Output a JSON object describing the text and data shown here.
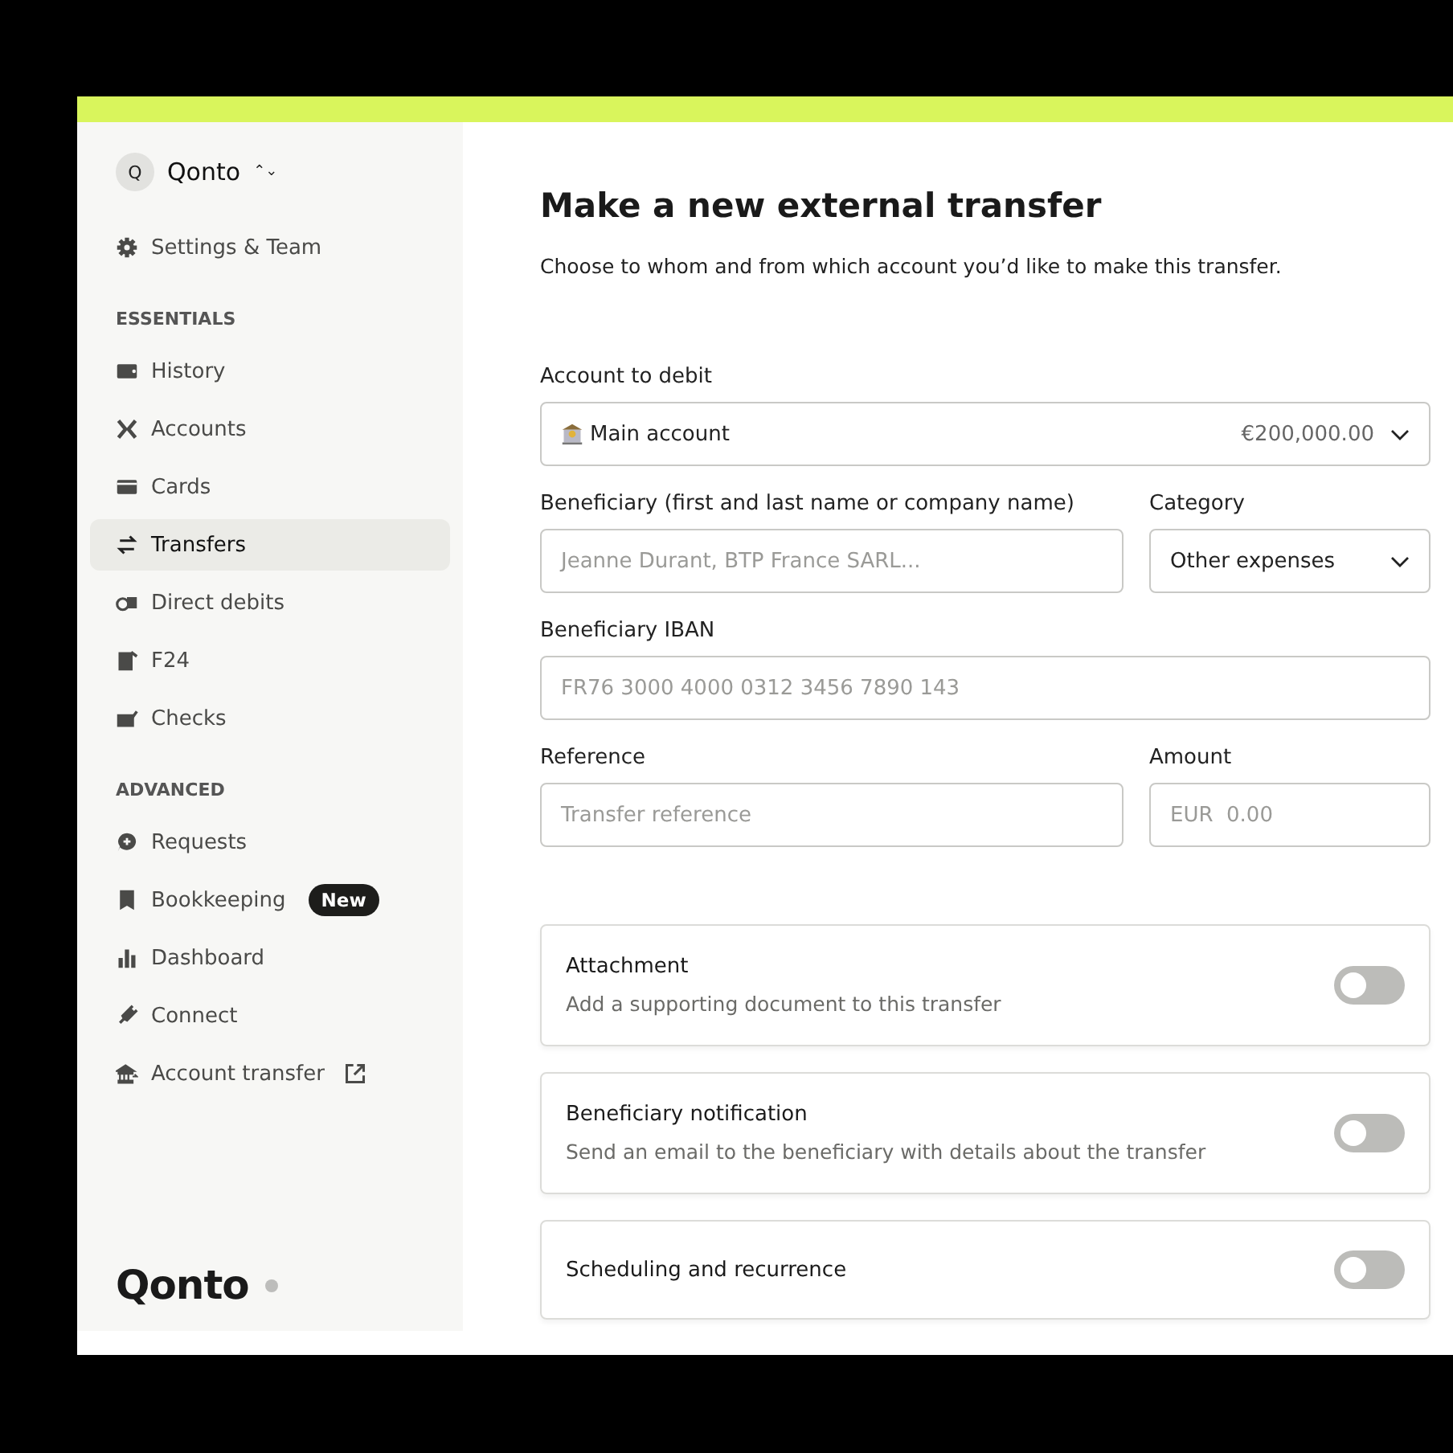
{
  "org": {
    "avatar": "Q",
    "name": "Qonto",
    "switch_icon": "⌃⌄"
  },
  "settings": {
    "label": "Settings & Team"
  },
  "sections": [
    {
      "title": "ESSENTIALS",
      "items": [
        {
          "label": "History",
          "selected": false
        },
        {
          "label": "Accounts",
          "selected": false
        },
        {
          "label": "Cards",
          "selected": false
        },
        {
          "label": "Transfers",
          "selected": true
        },
        {
          "label": "Direct debits",
          "selected": false
        },
        {
          "label": "F24",
          "selected": false
        },
        {
          "label": "Checks",
          "selected": false
        }
      ]
    },
    {
      "title": "ADVANCED",
      "items": [
        {
          "label": "Requests",
          "selected": false
        },
        {
          "label": "Bookkeeping",
          "selected": false,
          "badge": "New"
        },
        {
          "label": "Dashboard",
          "selected": false
        },
        {
          "label": "Connect",
          "selected": false
        },
        {
          "label": "Account transfer",
          "selected": false,
          "external": true
        }
      ]
    }
  ],
  "logo": "Qonto",
  "page": {
    "title": "Make a new external transfer",
    "subtitle": "Choose to whom and from which account you’d like to make this transfer."
  },
  "account": {
    "label": "Account to debit",
    "value": "Main account",
    "balance": "€200,000.00"
  },
  "beneficiary": {
    "label": "Beneficiary (first and last name or company name)",
    "placeholder": "Jeanne Durant, BTP France SARL..."
  },
  "category": {
    "label": "Category",
    "value": "Other expenses"
  },
  "iban": {
    "label": "Beneficiary IBAN",
    "placeholder": "FR76 3000 4000 0312 3456 7890 143"
  },
  "reference": {
    "label": "Reference",
    "placeholder": "Transfer reference"
  },
  "amount": {
    "label": "Amount",
    "placeholder": "EUR  0.00"
  },
  "options": [
    {
      "title": "Attachment",
      "description": "Add a supporting document to this transfer",
      "on": false
    },
    {
      "title": "Beneficiary notification",
      "description": "Send an email to the beneficiary with details about the transfer",
      "on": false
    },
    {
      "title": "Scheduling and recurrence",
      "on": false
    }
  ]
}
